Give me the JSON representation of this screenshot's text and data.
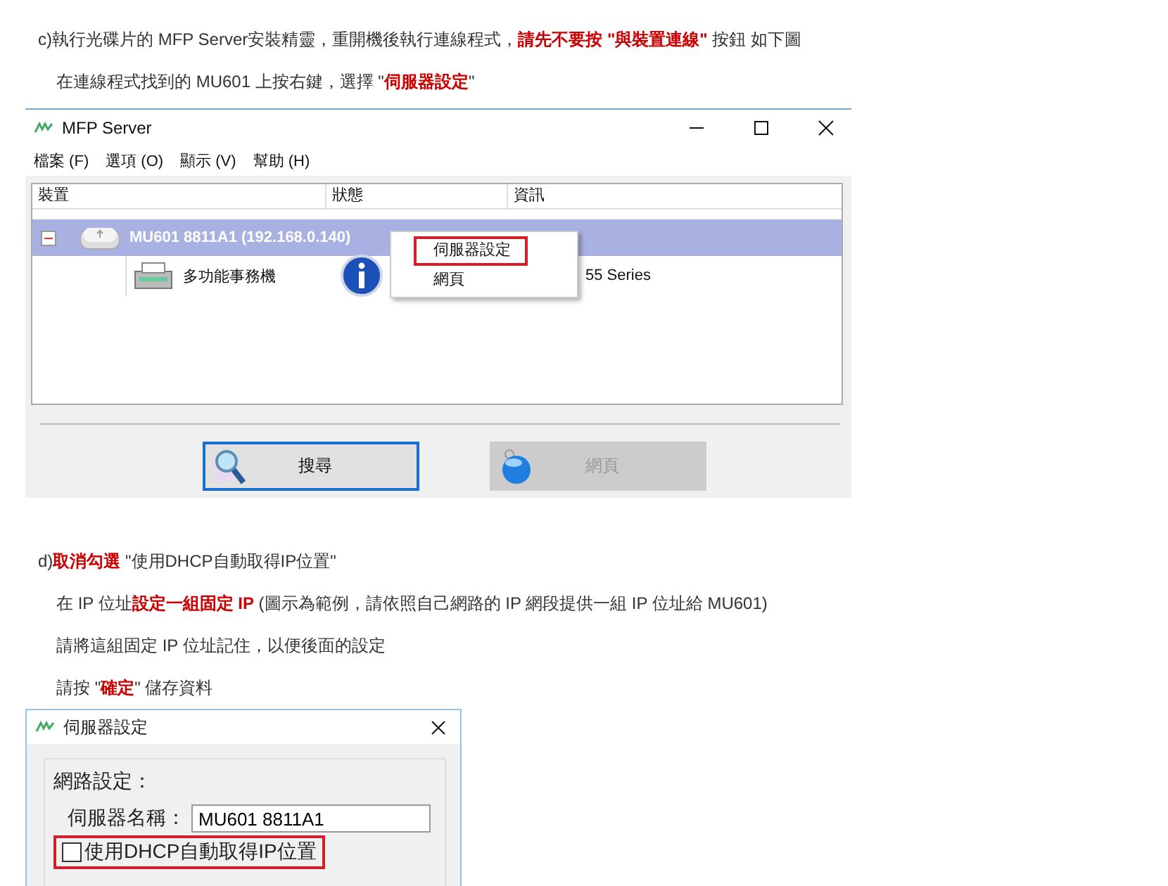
{
  "step_c": [
    "c)執行光碟片的 MFP Server安裝精靈，重開機後執行連線程式，**請先不要按 \"與裝置連線\"** 按鈕 如下圖",
    "在連線程式找到的 MU601 上按右鍵，選擇 \"**伺服器設定**\""
  ],
  "mfp_window": {
    "title": "MFP Server",
    "menu": [
      "檔案 (F)",
      "選項 (O)",
      "顯示 (V)",
      "幫助 (H)"
    ],
    "columns": [
      "裝置",
      "狀態",
      "資訊"
    ],
    "devices": [
      {
        "name": "MU601 8811A1 (192.168.0.140)",
        "selected": true,
        "expanded": true,
        "children": [
          {
            "name": "多功能事務機",
            "info": "55 Series"
          }
        ]
      }
    ],
    "context_menu": [
      {
        "label": "伺服器設定",
        "highlighted": true
      },
      {
        "label": "網頁",
        "highlighted": false
      }
    ],
    "buttons": [
      {
        "label": "搜尋",
        "kind": "search",
        "disabled": false,
        "focused": true
      },
      {
        "label": "網頁",
        "kind": "web",
        "disabled": true,
        "focused": false
      }
    ]
  },
  "step_d": [
    "d)**取消勾選** \"使用DHCP自動取得IP位置\"",
    "在 IP 位址**設定一組固定 IP** (圖示為範例，請依照自己網路的 IP 網段提供一組 IP 位址給 MU601)",
    "請將這組固定 IP 位址記住，以便後面的設定",
    "請按 \"**確定**\" 儲存資料"
  ],
  "server_window": {
    "title": "伺服器設定",
    "group_label": "網路設定：",
    "fields": [
      {
        "label": "伺服器名稱：",
        "value": "MU601 8811A1"
      }
    ],
    "dhcp": {
      "label": "使用DHCP自動取得IP位置",
      "checked": false,
      "highlighted": true
    }
  }
}
